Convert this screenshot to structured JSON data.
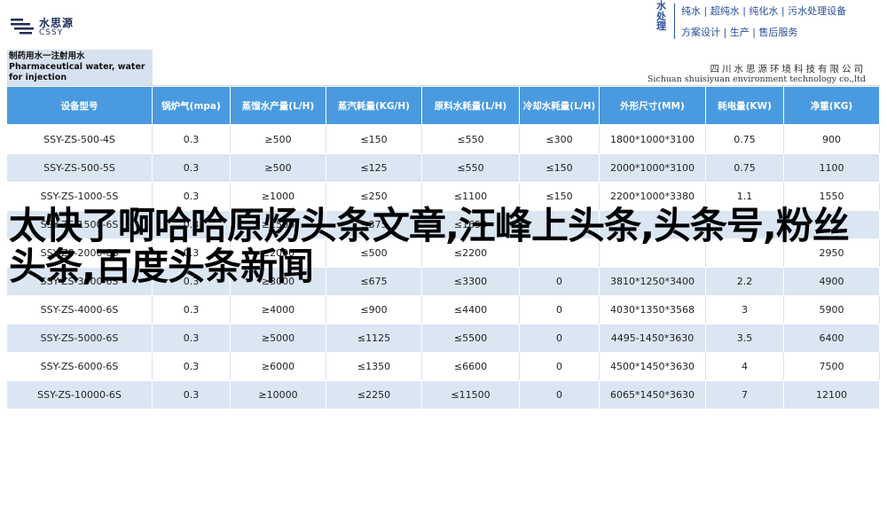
{
  "header": {
    "logo": {
      "name_cn": "水思源",
      "name_en": "CSSY"
    },
    "brand_vertical": "水处理",
    "slogan_line1": "纯水 | 超纯水 | 纯化水 | 污水处理设备",
    "slogan_line2": "方案设计 | 生产 | 售后服务"
  },
  "table": {
    "title": "制药用水一注射用水 Pharmaceutical water, water for injection",
    "company_cn": "四川水思源环境科技有限公司",
    "company_en": "Sichuan shuisiyuan environment technology co.,ltd",
    "columns": [
      "设备型号",
      "锅炉气(mpa)",
      "蒸馏水产量(L/H)",
      "蒸汽耗量(KG/H)",
      "原料水耗量(L/H)",
      "冷却水耗量(L/H)",
      "外形尺寸(MM)",
      "耗电量(KW)",
      "净重(KG)"
    ],
    "rows": [
      [
        "SSY-ZS-500-4S",
        "0.3",
        "≥500",
        "≤150",
        "≤550",
        "≤300",
        "1800*1000*3100",
        "0.75",
        "900"
      ],
      [
        "SSY-ZS-500-5S",
        "0.3",
        "≥500",
        "≤125",
        "≤550",
        "≤150",
        "2000*1000*3100",
        "0.75",
        "1100"
      ],
      [
        "SSY-ZS-1000-5S",
        "0.3",
        "≥1000",
        "≤250",
        "≤1100",
        "≤150",
        "2200*1000*3380",
        "1.1",
        "1550"
      ],
      [
        "SSY-ZS-1500-6S",
        "0.3",
        "≥1500",
        "≤375",
        "≤1650",
        "",
        "",
        "",
        ""
      ],
      [
        "SSY-ZS-2000-6S",
        "0.3",
        "≥2000",
        "≤500",
        "≤2200",
        "",
        "",
        "",
        "2950"
      ],
      [
        "SSY-ZS-3000-6S",
        "0.3",
        "≥3000",
        "≤675",
        "≤3300",
        "0",
        "3810*1250*3400",
        "2.2",
        "4900"
      ],
      [
        "SSY-ZS-4000-6S",
        "0.3",
        "≥4000",
        "≤900",
        "≤4400",
        "0",
        "4030*1350*3568",
        "3",
        "5900"
      ],
      [
        "SSY-ZS-5000-6S",
        "0.3",
        "≥5000",
        "≤1125",
        "≤5500",
        "0",
        "4495-1450*3630",
        "3.5",
        "6400"
      ],
      [
        "SSY-ZS-6000-6S",
        "0.3",
        "≥6000",
        "≤1350",
        "≤6600",
        "0",
        "4500*1450*3630",
        "4",
        "7500"
      ],
      [
        "SSY-ZS-10000-6S",
        "0.3",
        "≥10000",
        "≤2250",
        "≤11500",
        "0",
        "6065*1450*3630",
        "7",
        "12100"
      ]
    ]
  },
  "overlay_text": "太快了啊哈哈原炀头条文章,汪峰上头条,头条号,粉丝头条,百度头条新闻",
  "colors": {
    "header_blue": "#4a9ae0",
    "stripe": "#dbe6f3",
    "brand_blue": "#2a4e9b"
  }
}
